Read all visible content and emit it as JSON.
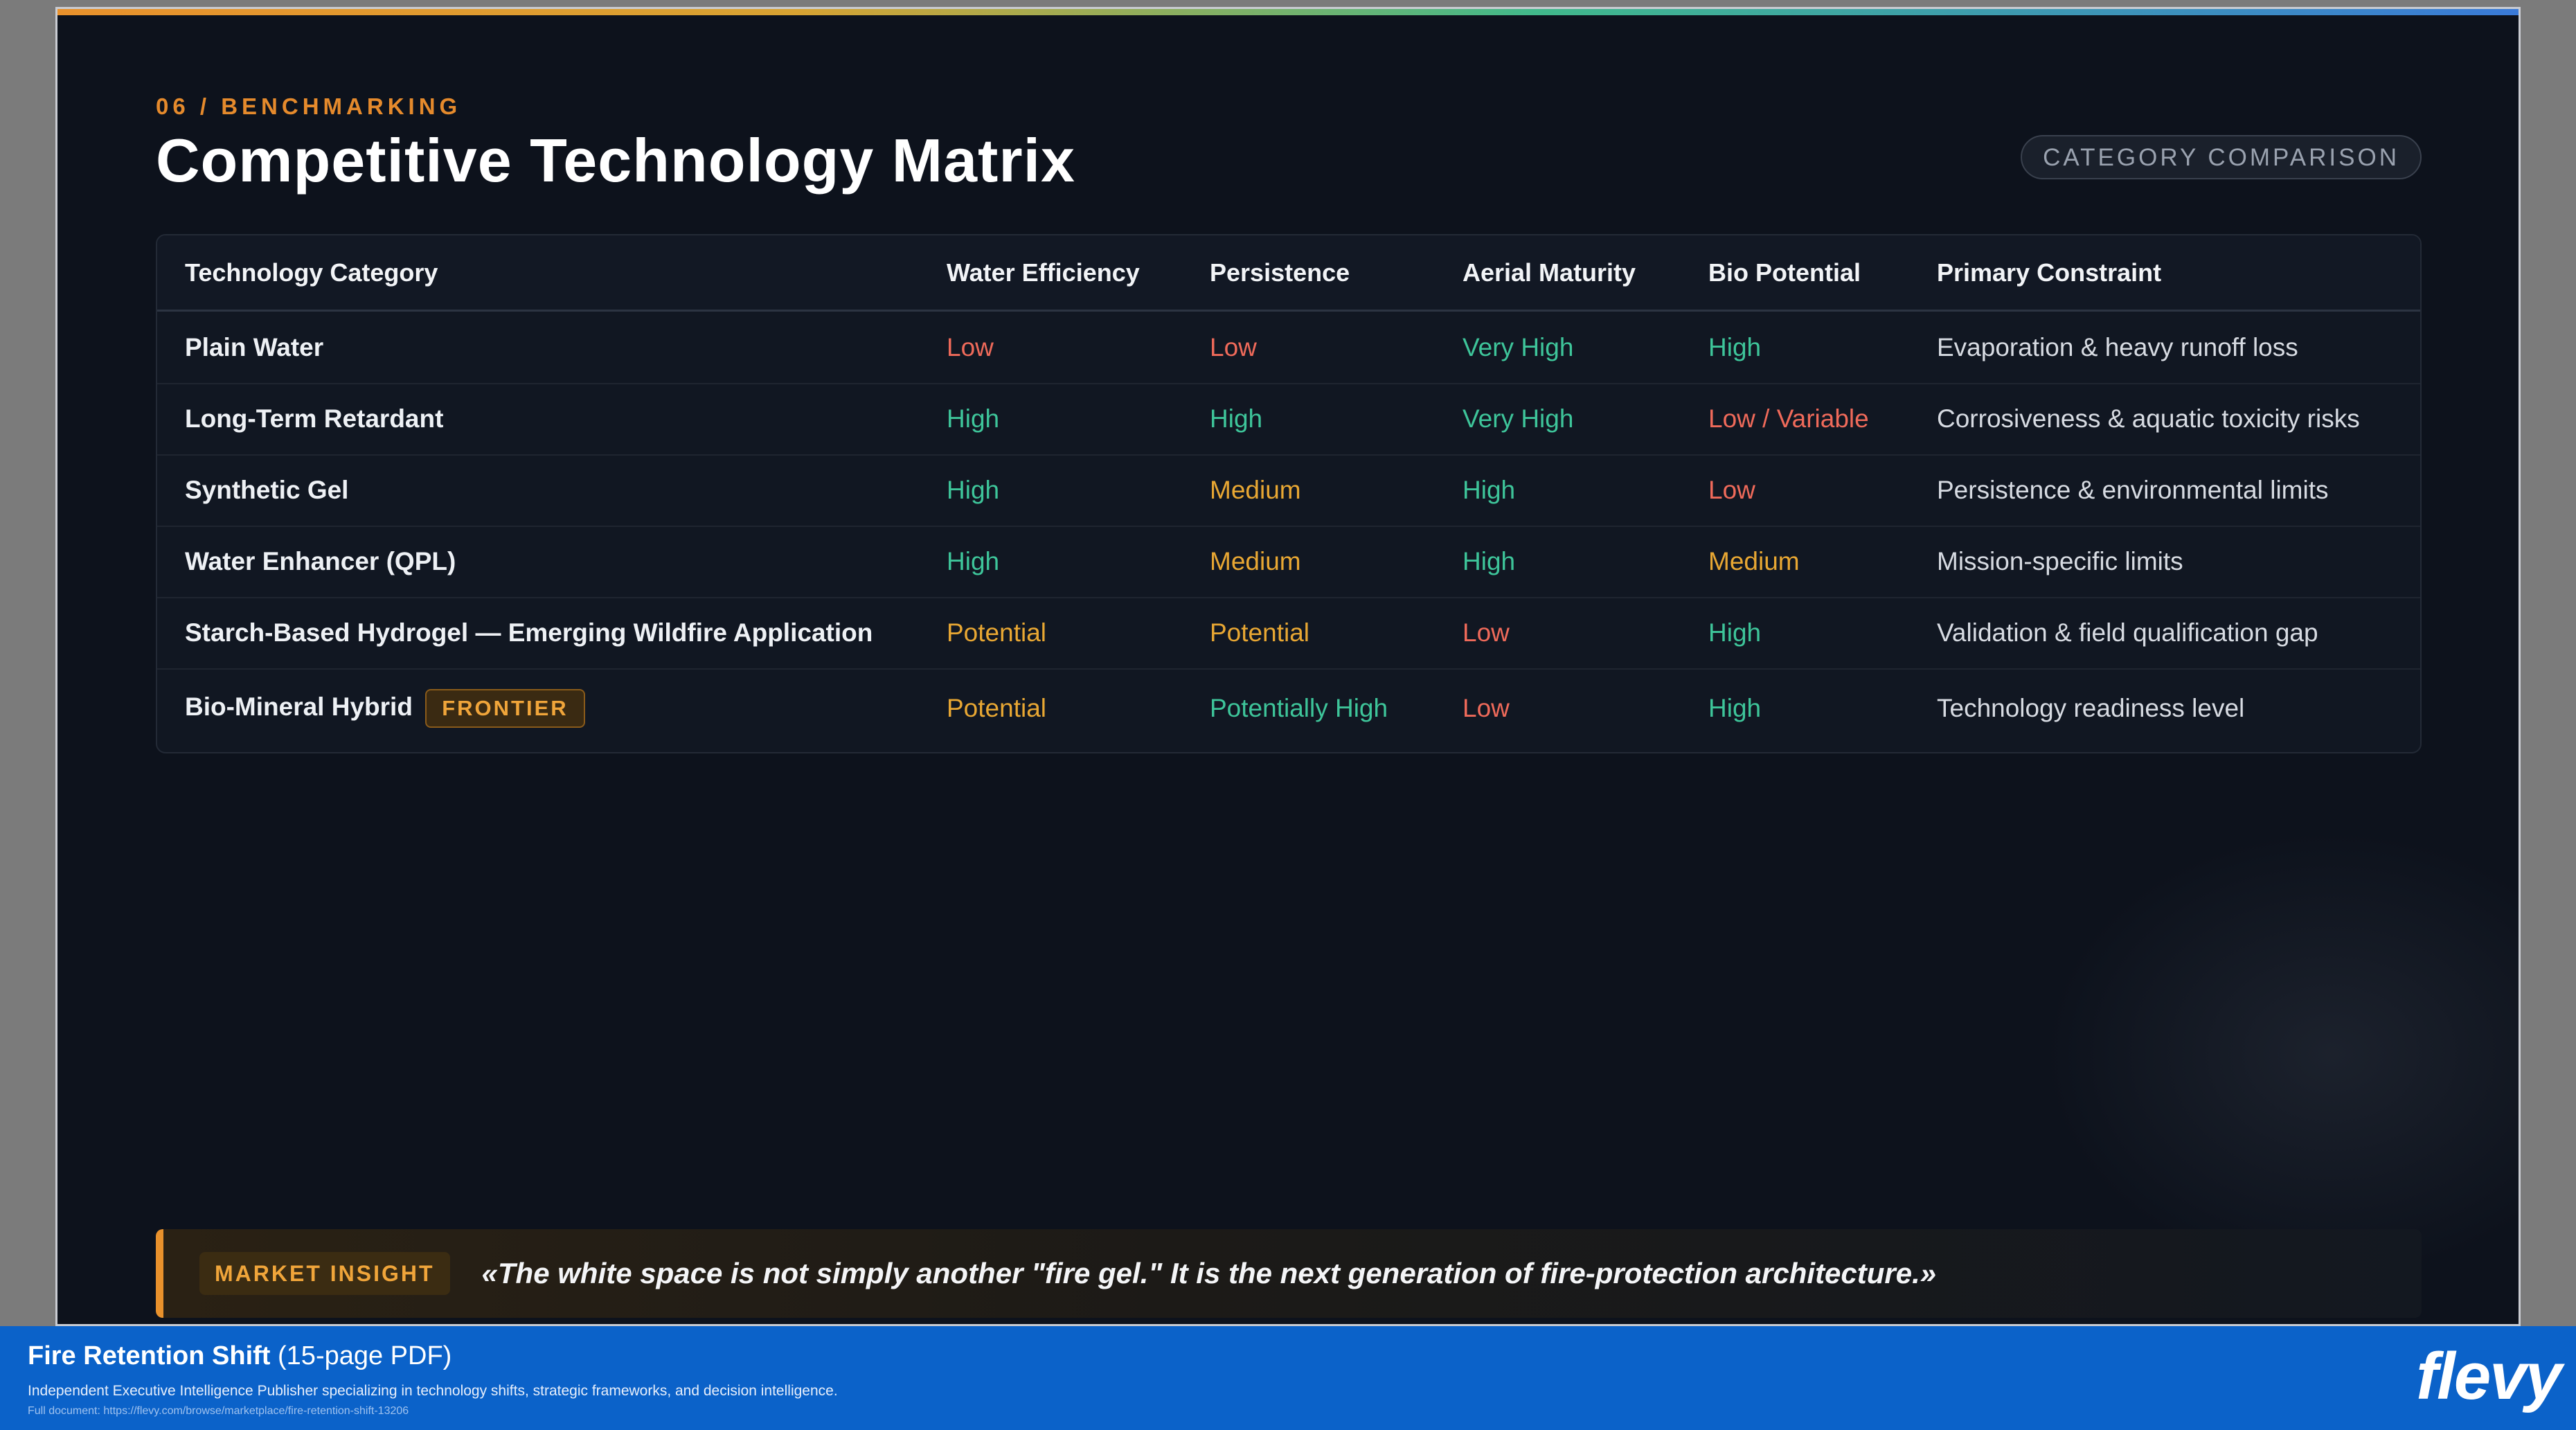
{
  "slide": {
    "kicker": "06 / BENCHMARKING",
    "title": "Competitive Technology Matrix",
    "pill": "CATEGORY COMPARISON",
    "accent_color": "#e8912c",
    "background_color": "#0d121c"
  },
  "table": {
    "columns": [
      "Technology Category",
      "Water Efficiency",
      "Persistence",
      "Aerial Maturity",
      "Bio Potential",
      "Primary Constraint"
    ],
    "rows": [
      {
        "name": "Plain Water",
        "badge": "",
        "water": "Low",
        "persistence": "Low",
        "aerial": "Very High",
        "bio": "High",
        "constraint": "Evaporation & heavy runoff loss"
      },
      {
        "name": "Long-Term Retardant",
        "badge": "",
        "water": "High",
        "persistence": "High",
        "aerial": "Very High",
        "bio": "Low / Variable",
        "constraint": "Corrosiveness & aquatic toxicity risks"
      },
      {
        "name": "Synthetic Gel",
        "badge": "",
        "water": "High",
        "persistence": "Medium",
        "aerial": "High",
        "bio": "Low",
        "constraint": "Persistence & environmental limits"
      },
      {
        "name": "Water Enhancer (QPL)",
        "badge": "",
        "water": "High",
        "persistence": "Medium",
        "aerial": "High",
        "bio": "Medium",
        "constraint": "Mission-specific limits"
      },
      {
        "name": "Starch-Based Hydrogel — Emerging Wildfire Application",
        "badge": "",
        "water": "Potential",
        "persistence": "Potential",
        "aerial": "Low",
        "bio": "High",
        "constraint": "Validation & field qualification gap"
      },
      {
        "name": "Bio-Mineral Hybrid",
        "badge": "FRONTIER",
        "water": "Potential",
        "persistence": "Potentially High",
        "aerial": "Low",
        "bio": "High",
        "constraint": "Technology readiness level"
      }
    ],
    "rating_colors": {
      "low": "#ef6a5a",
      "high": "#3ec59a",
      "medium": "#e8a733"
    }
  },
  "insight": {
    "tag": "MARKET INSIGHT",
    "quote": "«The white space is not simply another \"fire gel.\" It is the next generation of fire-protection architecture.»"
  },
  "footer": {
    "title": "Fire Retention Shift",
    "title_suffix": "(15-page PDF)",
    "subtitle": "Independent Executive Intelligence Publisher specializing in technology shifts, strategic frameworks, and decision intelligence.",
    "link": "Full document: https://flevy.com/browse/marketplace/fire-retention-shift-13206",
    "logo": "flevy",
    "background_color": "#0b62c9"
  }
}
